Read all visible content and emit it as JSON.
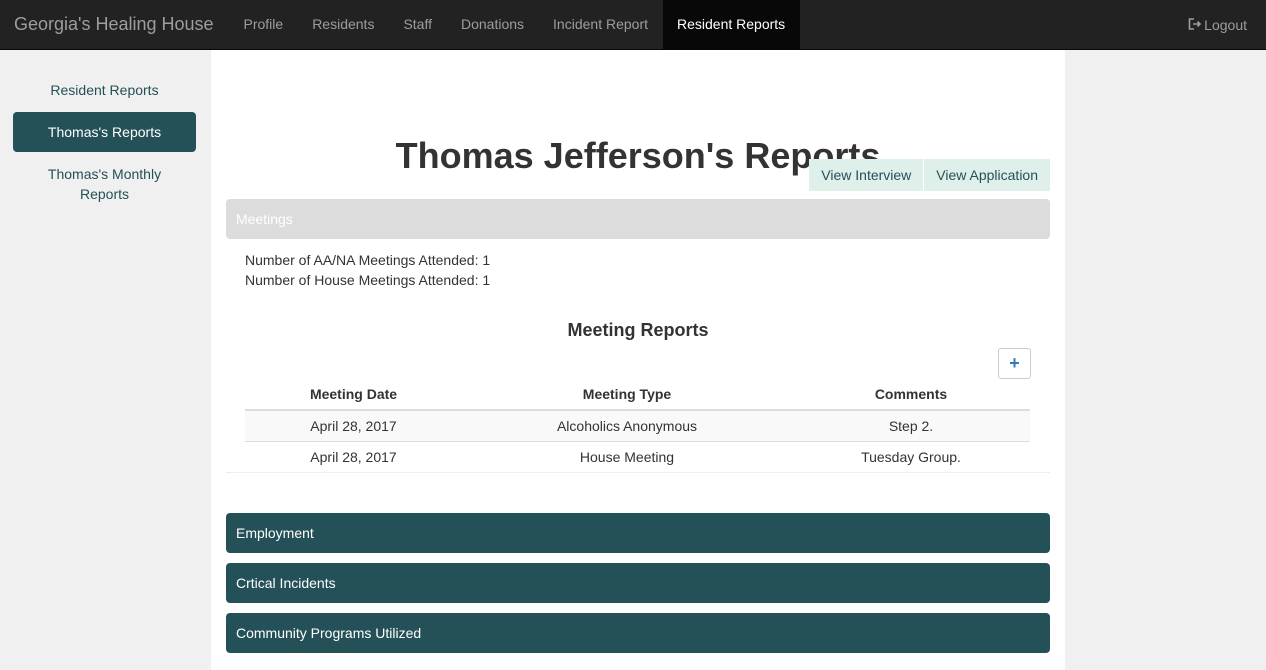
{
  "navbar": {
    "brand": "Georgia's Healing House",
    "items": [
      {
        "label": "Profile"
      },
      {
        "label": "Residents"
      },
      {
        "label": "Staff"
      },
      {
        "label": "Donations"
      },
      {
        "label": "Incident Report"
      },
      {
        "label": "Resident Reports",
        "active": true
      }
    ],
    "logout": "Logout",
    "logout_icon": "logout-icon"
  },
  "sidebar": {
    "items": [
      {
        "label": "Resident Reports"
      },
      {
        "label": "Thomas's Reports",
        "active": true
      },
      {
        "label": "Thomas's Monthly Reports"
      }
    ]
  },
  "main": {
    "title": "Thomas Jefferson's Reports",
    "buttons": {
      "view_interview": "View Interview",
      "view_application": "View Application"
    },
    "meetings_heading": "Meetings",
    "aa_na": "Number of AA/NA Meetings Attended: 1",
    "house": "Number of House Meetings Attended: 1",
    "reports_title": "Meeting Reports",
    "add_label": "+",
    "table": {
      "headers": [
        "Meeting Date",
        "Meeting Type",
        "Comments"
      ],
      "rows": [
        [
          "April 28, 2017",
          "Alcoholics Anonymous",
          "Step 2."
        ],
        [
          "April 28, 2017",
          "House Meeting",
          "Tuesday Group."
        ]
      ]
    },
    "sections": [
      "Employment",
      "Crtical Incidents",
      "Community Programs Utilized"
    ]
  },
  "colors": {
    "navbar_bg": "#222222",
    "accent": "#245058",
    "light_button": "#dff0eb",
    "grey_heading": "#dcdcdc"
  }
}
